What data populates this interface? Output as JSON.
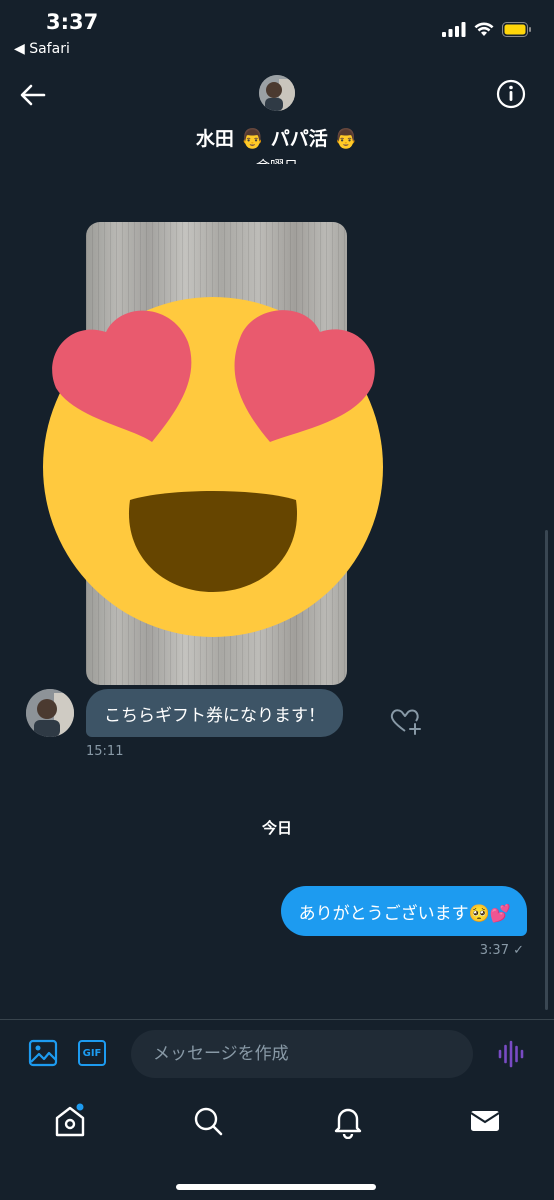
{
  "status_bar": {
    "time": "3:37",
    "back_app": "◀ Safari"
  },
  "header": {
    "title": "水田 👨 パパ活 👨",
    "subtitle": "金曜日"
  },
  "messages": {
    "received_text": "こちらギフト券になります！",
    "received_time": "15:11",
    "day_separator": "今日",
    "sent_text": "ありがとうございます🥺💕",
    "sent_time": "3:37 ✓"
  },
  "composer": {
    "placeholder": "メッセージを作成",
    "gif_label": "GIF"
  },
  "colors": {
    "background": "#15202b",
    "accent": "#1d9bf0",
    "received_bubble": "#3d5466",
    "voice": "#794bc4"
  },
  "icons": [
    "back-arrow-icon",
    "info-icon",
    "image-icon",
    "gif-icon",
    "voice-icon",
    "heart-plus-icon",
    "home-icon",
    "search-icon",
    "bell-icon",
    "mail-icon"
  ]
}
